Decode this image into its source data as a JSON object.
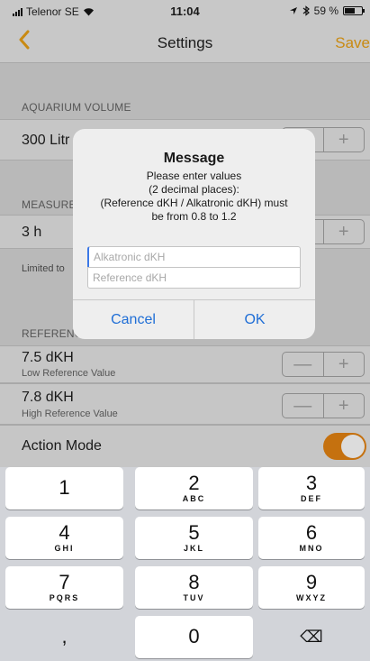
{
  "status_bar": {
    "carrier": "Telenor SE",
    "time": "11:04",
    "battery": "59 %"
  },
  "nav": {
    "back_icon": "chevron-left-icon",
    "title": "Settings",
    "save_label": "Save"
  },
  "sections": {
    "aquarium_volume": {
      "header": "AQUARIUM VOLUME",
      "value": "300 Litr"
    },
    "measure": {
      "header": "MEASURE",
      "value": "3 h",
      "note": "Limited to"
    },
    "reference": {
      "header": "REFERENCE VALUES"
    }
  },
  "reference_rows": [
    {
      "value": "7.5 dKH",
      "label": "Low Reference Value"
    },
    {
      "value": "7.8 dKH",
      "label": "High Reference Value"
    }
  ],
  "action_mode": {
    "label": "Action Mode",
    "enabled": true
  },
  "stepper": {
    "minus": "—",
    "plus": "+"
  },
  "alert": {
    "title": "Message",
    "message_lines": [
      "Please enter values",
      "(2 decimal places):",
      "(Reference dKH / Alkatronic dKH) must",
      "be from 0.8 to 1.2"
    ],
    "field1_placeholder": "Alkatronic dKH",
    "field2_placeholder": "Reference dKH",
    "cancel_label": "Cancel",
    "ok_label": "OK"
  },
  "keypad": [
    {
      "num": "1",
      "letters": ""
    },
    {
      "num": "2",
      "letters": "ABC"
    },
    {
      "num": "3",
      "letters": "DEF"
    },
    {
      "num": "4",
      "letters": "GHI"
    },
    {
      "num": "5",
      "letters": "JKL"
    },
    {
      "num": "6",
      "letters": "MNO"
    },
    {
      "num": "7",
      "letters": "PQRS"
    },
    {
      "num": "8",
      "letters": "TUV"
    },
    {
      "num": "9",
      "letters": "WXYZ"
    },
    {
      "num": ",",
      "letters": ""
    },
    {
      "num": "0",
      "letters": ""
    },
    {
      "num": "⌫",
      "letters": ""
    }
  ],
  "colors": {
    "accent": "#c98a12",
    "toggle_on": "#c5710f",
    "link_blue": "#1f6ed6"
  }
}
